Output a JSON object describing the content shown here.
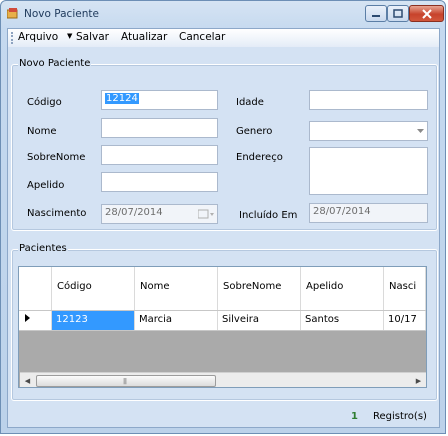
{
  "window": {
    "title": "Novo Paciente"
  },
  "menu": {
    "arquivo": "Arquivo",
    "salvar": "Salvar",
    "atualizar": "Atualizar",
    "cancelar": "Cancelar"
  },
  "form": {
    "group_title": "Novo Paciente",
    "codigo_label": "Código",
    "codigo_value": "12124",
    "nome_label": "Nome",
    "nome_value": "",
    "sobrenome_label": "SobreNome",
    "sobrenome_value": "",
    "apelido_label": "Apelido",
    "apelido_value": "",
    "nascimento_label": "Nascimento",
    "nascimento_value": "28/07/2014",
    "idade_label": "Idade",
    "idade_value": "",
    "genero_label": "Genero",
    "genero_value": "",
    "endereco_label": "Endereço",
    "endereco_value": "",
    "incluido_label": "Incluído Em",
    "incluido_value": "28/07/2014"
  },
  "pacientes": {
    "group_title": "Pacientes",
    "columns": [
      "Código",
      "Nome",
      "SobreNome",
      "Apelido",
      "Nasci"
    ],
    "rows": [
      {
        "codigo": "12123",
        "nome": "Marcia",
        "sobrenome": "Silveira",
        "apelido": "Santos",
        "nascimento": "10/17"
      }
    ]
  },
  "status": {
    "count": "1",
    "label": "Registro(s)"
  },
  "colors": {
    "selection": "#3399ff",
    "close_button": "#c7432c",
    "count": "#2e7d32"
  }
}
